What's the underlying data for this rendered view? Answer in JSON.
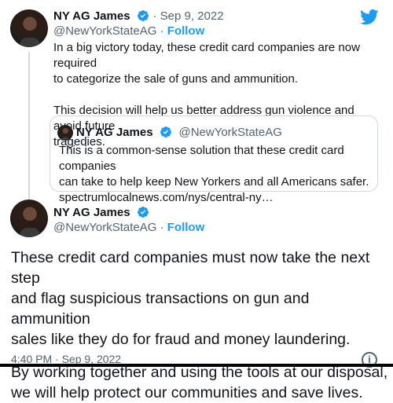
{
  "tweet1": {
    "name": "NY AG James",
    "date": "· Sep 9, 2022",
    "handle": "@NewYorkStateAG",
    "follow_sep": " · ",
    "follow": "Follow",
    "line1": "In a big victory today, these credit card companies are now required",
    "line2": "to categorize the sale of guns and ammunition.",
    "line3": "This decision will help us better address gun violence and avoid future",
    "line4": "tragedies."
  },
  "quote": {
    "name": "NY AG James",
    "handle": "@NewYorkStateAG",
    "line1": "This is a common-sense solution that these credit card companies",
    "line2": "can take to help keep New Yorkers and all Americans safer.",
    "line3": "spectrumlocalnews.com/nys/central-ny…"
  },
  "tweet2": {
    "name": "NY AG James",
    "handle": "@NewYorkStateAG",
    "follow_sep": " · ",
    "follow": "Follow",
    "line1": "These credit card companies must now take the next step",
    "line2": "and flag suspicious transactions on gun and ammunition",
    "line3": "sales like they do for fraud and money laundering.",
    "line4": "By working together and using the tools at our disposal,",
    "line5": "we will help protect our communities and save lives.",
    "timestamp": "4:40 PM · Sep 9, 2022"
  },
  "icons": {
    "twitter": "twitter-bird-icon",
    "verified": "verified-badge-icon",
    "info": "info-icon"
  },
  "colors": {
    "accent": "#1d9bf0",
    "muted": "#536471",
    "border": "#cfd9de",
    "text": "#0f1419"
  }
}
